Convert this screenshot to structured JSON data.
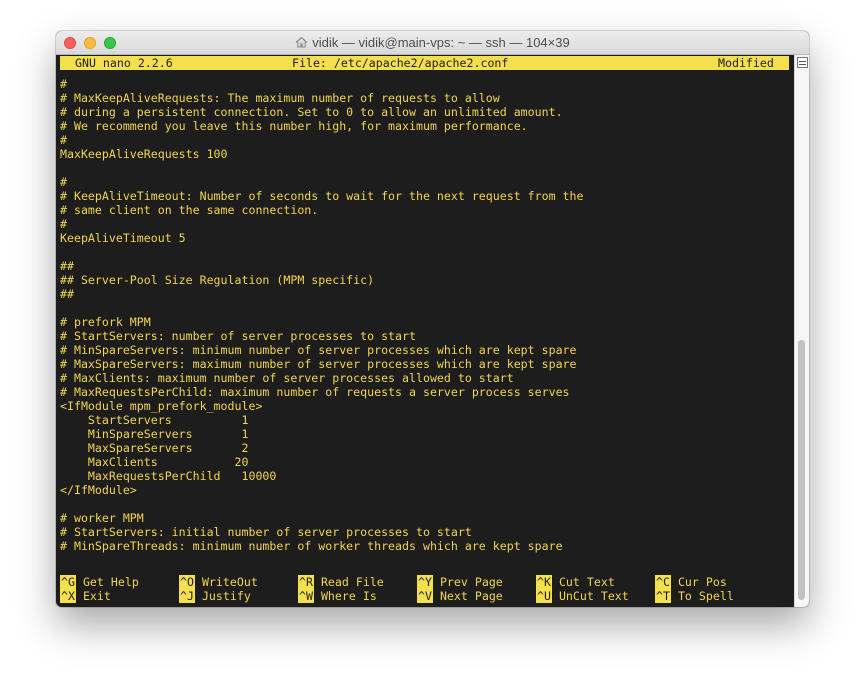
{
  "window": {
    "title": "vidik — vidik@main-vps: ~ — ssh — 104×39"
  },
  "nano": {
    "version": "GNU nano 2.2.6",
    "file": "File: /etc/apache2/apache2.conf",
    "status": "Modified"
  },
  "buffer_lines": [
    "#",
    "# MaxKeepAliveRequests: The maximum number of requests to allow",
    "# during a persistent connection. Set to 0 to allow an unlimited amount.",
    "# We recommend you leave this number high, for maximum performance.",
    "#",
    "MaxKeepAliveRequests 100",
    "",
    "#",
    "# KeepAliveTimeout: Number of seconds to wait for the next request from the",
    "# same client on the same connection.",
    "#",
    "KeepAliveTimeout 5",
    "",
    "##",
    "## Server-Pool Size Regulation (MPM specific)",
    "##",
    "",
    "# prefork MPM",
    "# StartServers: number of server processes to start",
    "# MinSpareServers: minimum number of server processes which are kept spare",
    "# MaxSpareServers: maximum number of server processes which are kept spare",
    "# MaxClients: maximum number of server processes allowed to start",
    "# MaxRequestsPerChild: maximum number of requests a server process serves",
    "<IfModule mpm_prefork_module>",
    "    StartServers          1",
    "    MinSpareServers       1",
    "    MaxSpareServers       2",
    "    MaxClients           20",
    "    MaxRequestsPerChild   10000",
    "</IfModule>",
    "",
    "# worker MPM",
    "# StartServers: initial number of server processes to start",
    "# MinSpareThreads: minimum number of worker threads which are kept spare"
  ],
  "shortcuts": [
    {
      "key": "^G",
      "label": "Get Help"
    },
    {
      "key": "^O",
      "label": "WriteOut"
    },
    {
      "key": "^R",
      "label": "Read File"
    },
    {
      "key": "^Y",
      "label": "Prev Page"
    },
    {
      "key": "^K",
      "label": "Cut Text"
    },
    {
      "key": "^C",
      "label": "Cur Pos"
    },
    {
      "key": "^X",
      "label": "Exit"
    },
    {
      "key": "^J",
      "label": "Justify"
    },
    {
      "key": "^W",
      "label": "Where Is"
    },
    {
      "key": "^V",
      "label": "Next Page"
    },
    {
      "key": "^U",
      "label": "UnCut Text"
    },
    {
      "key": "^T",
      "label": "To Spell"
    }
  ],
  "colors": {
    "terminal_bg": "#1d1d1d",
    "terminal_fg": "#f4d54f",
    "highlight": "#f4e04d"
  },
  "icons": {
    "title": "home-icon",
    "scrollbar": "scroll-menu-icon"
  }
}
